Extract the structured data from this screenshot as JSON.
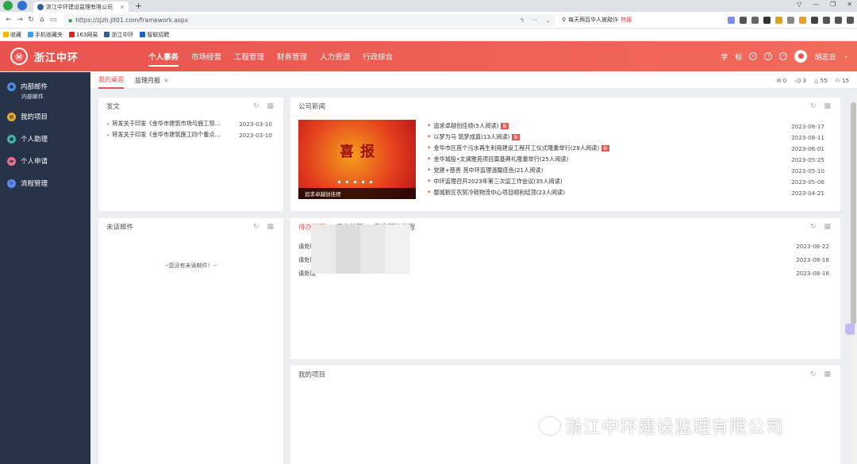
{
  "browser": {
    "tab_title": "浙江中环建设监理有限公司",
    "url": "https://zjzh.jlt01.com/framework.aspx",
    "search_text": "每天两百华人被敲诈",
    "search_hot": "热搜",
    "bookmarks": [
      "收藏",
      "手机收藏夹",
      "163网易",
      "浙江中环",
      "智联招聘"
    ]
  },
  "header": {
    "brand": "浙江中环",
    "nav": [
      "个人事务",
      "市场经营",
      "工程管理",
      "财务管理",
      "人力资源",
      "行政综合"
    ],
    "right": {
      "study": "学",
      "mark": "标",
      "user": "胡志云"
    }
  },
  "sidebar": {
    "items": [
      {
        "label": "内部邮件",
        "sub": "内部邮件",
        "color": "#4a90e2"
      },
      {
        "label": "我的项目",
        "color": "#f5a623"
      },
      {
        "label": "个人助理",
        "color": "#3fb8a4"
      },
      {
        "label": "个人申请",
        "color": "#ef6b8a"
      },
      {
        "label": "流程管理",
        "color": "#5b8def"
      }
    ]
  },
  "tabs": {
    "items": [
      "我的桌面",
      "监理月报"
    ],
    "stats": {
      "mail": "0",
      "notice": "3",
      "bell": "55",
      "user": "15"
    }
  },
  "panels": {
    "fawen": {
      "title": "发文",
      "rows": [
        {
          "text": "转发关于印发《金华市建筑市场与施工现...",
          "date": "2023-03-10"
        },
        {
          "text": "转发关于印发《金华市建筑施工四个重点...",
          "date": "2023-03-10"
        }
      ]
    },
    "news": {
      "title": "公司新闻",
      "banner_title": "喜报",
      "banner_caption": "追求卓越创佳绩",
      "new_tag": "新",
      "rows": [
        {
          "text": "追求卓越创佳绩(5人阅读)",
          "date": "2023-08-17",
          "new": true
        },
        {
          "text": "以梦为马 筑梦成真(13人阅读)",
          "date": "2023-08-11",
          "new": true
        },
        {
          "text": "金华市区首个污水再生利用建设工程开工仪式隆重举行(29人阅读)",
          "date": "2023-06-01",
          "new": true
        },
        {
          "text": "金华城投•文澜雅苑项目奠基典礼隆重举行(25人阅读)",
          "date": "2023-05-25",
          "new": false
        },
        {
          "text": "党建+慈善 亮中环监理温暖底色(21人阅读)",
          "date": "2023-05-10",
          "new": false
        },
        {
          "text": "中环监理召开2023年第三次监工作会议(35人阅读)",
          "date": "2023-05-06",
          "new": false
        },
        {
          "text": "婺城新区农贸冷链物流中心项目顺利结顶(23人阅读)",
          "date": "2023-04-21",
          "new": false
        }
      ]
    },
    "mail": {
      "title": "未读邮件",
      "empty": "--您没有未读邮件！--"
    },
    "flow": {
      "tabs": [
        "待办流程",
        "已办流程",
        "我发起的流程"
      ],
      "rows": [
        {
          "text": "请处理",
          "date": "2023-08-22"
        },
        {
          "text": "请处理",
          "date": "2023-08-18"
        },
        {
          "text": "请处理",
          "date": "2023-08-18"
        }
      ]
    },
    "project": {
      "title": "我的项目"
    }
  },
  "watermark": "浙江中环建设监理有限公司"
}
